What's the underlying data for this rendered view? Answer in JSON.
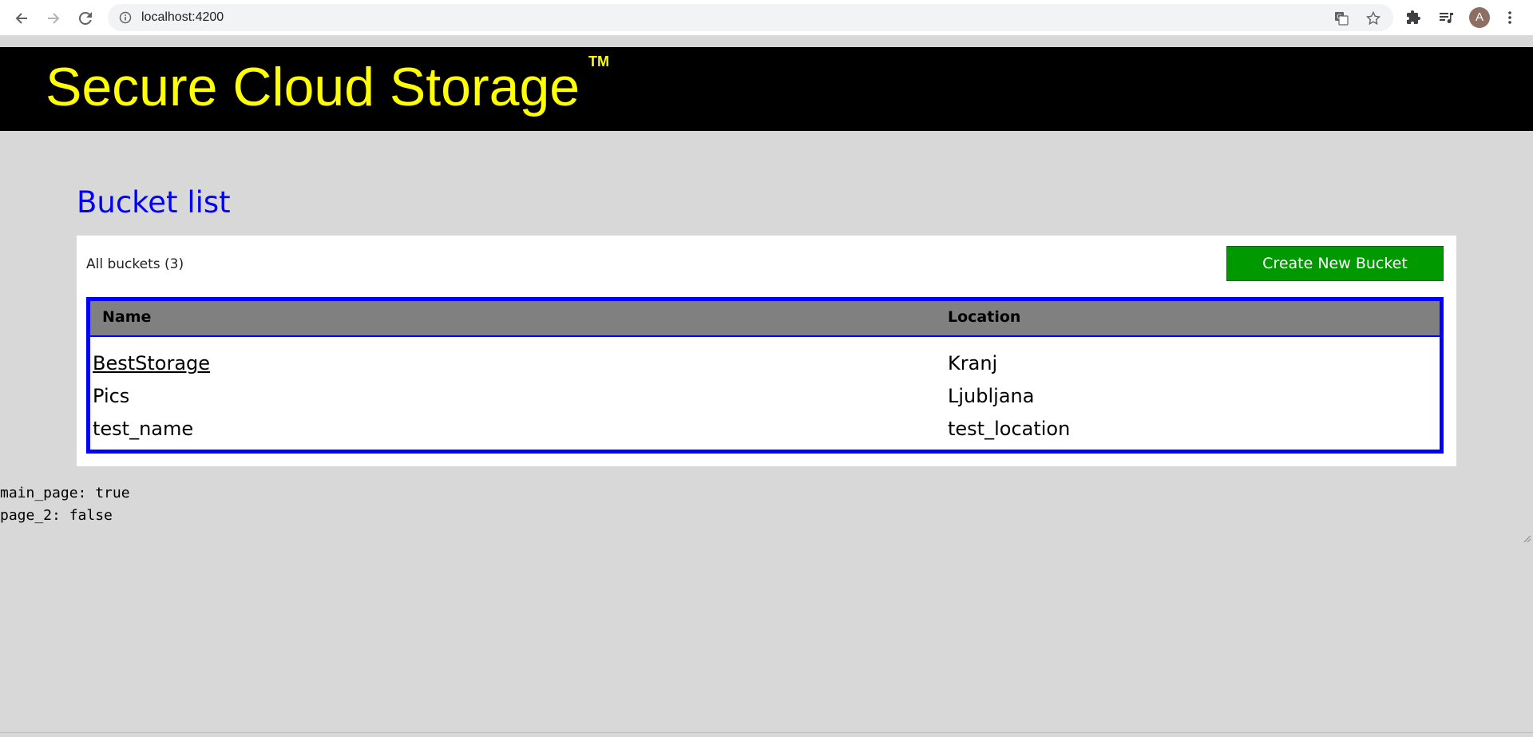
{
  "browser": {
    "url": "localhost:4200",
    "avatar_initial": "A"
  },
  "header": {
    "title": "Secure Cloud Storage",
    "trademark": "TM"
  },
  "main": {
    "page_title": "Bucket list",
    "count_label": "All buckets (3)",
    "create_button_label": "Create New Bucket",
    "table": {
      "columns": [
        "Name",
        "Location"
      ],
      "rows": [
        {
          "name": "BestStorage",
          "location": "Kranj"
        },
        {
          "name": "Pics",
          "location": "Ljubljana"
        },
        {
          "name": "test_name",
          "location": "test_location"
        }
      ]
    }
  },
  "debug": {
    "line1": "main_page: true",
    "line2": "page_2: false"
  },
  "colors": {
    "header_bg": "#000000",
    "title_color": "#ffff00",
    "page_title_color": "#0000ff",
    "table_border": "#0000ff",
    "table_header_bg": "#808080",
    "button_bg": "#009900",
    "page_bg": "#d8d8d8"
  },
  "icons": [
    "back-arrow-icon",
    "forward-arrow-icon",
    "reload-icon",
    "info-icon",
    "translate-icon",
    "star-icon",
    "extensions-icon",
    "media-control-icon",
    "more-vert-icon"
  ]
}
